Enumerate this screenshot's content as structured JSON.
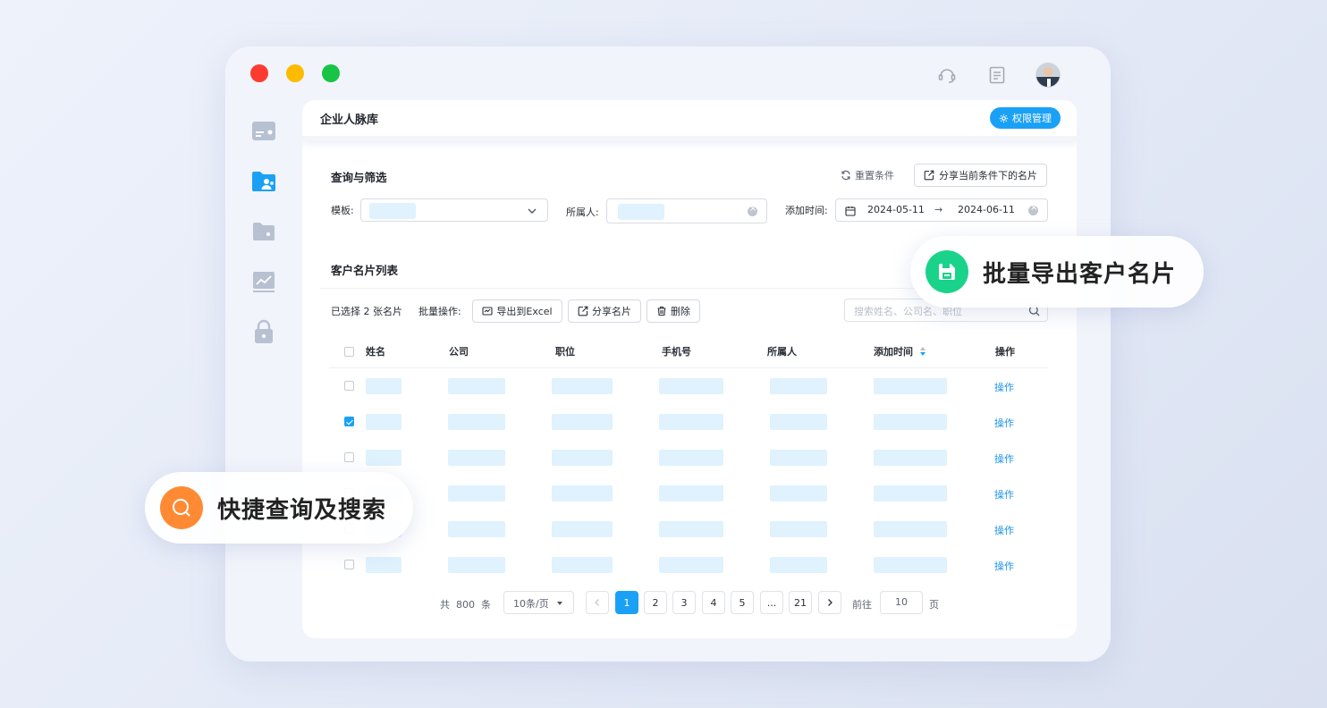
{
  "window": {
    "controls": [
      "close",
      "minimize",
      "maximize"
    ],
    "top_icons": [
      "headset-icon",
      "document-icon",
      "avatar"
    ]
  },
  "sidebar": {
    "items": [
      "card-icon",
      "contacts-folder-icon",
      "folder-icon",
      "chart-icon",
      "lock-icon"
    ],
    "active_index": 1
  },
  "header": {
    "title": "企业人脉库",
    "permission_button": "权限管理"
  },
  "filter": {
    "title": "查询与筛选",
    "reset": "重置条件",
    "share": "分享当前条件下的名片",
    "template_label": "模板:",
    "owner_label": "所属人:",
    "time_label": "添加时间:",
    "date_start": "2024-05-11",
    "date_arrow": "→",
    "date_end": "2024-06-11"
  },
  "list": {
    "title": "客户名片列表",
    "selected_prefix": "已选择",
    "selected_count": "2",
    "selected_suffix": "张名片",
    "batch_label": "批量操作:",
    "export_button": "导出到Excel",
    "share_button": "分享名片",
    "delete_button": "删除",
    "search_placeholder": "搜索姓名、公司名、职位"
  },
  "table": {
    "headers": [
      "姓名",
      "公司",
      "职位",
      "手机号",
      "所属人",
      "添加时间",
      "操作"
    ],
    "row_action": "操作",
    "rows_checked": [
      false,
      true,
      false,
      false,
      false,
      false
    ]
  },
  "pagination": {
    "total_prefix": "共",
    "total": "800",
    "total_suffix": "条",
    "page_size": "10条/页",
    "pages": [
      "1",
      "2",
      "3",
      "4",
      "5",
      "...",
      "21"
    ],
    "current": "1",
    "goto_label": "前往",
    "goto_value": "10",
    "goto_suffix": "页"
  },
  "callouts": {
    "export": "批量导出客户名片",
    "search": "快捷查询及搜索"
  },
  "colors": {
    "primary": "#1aa1f6",
    "export_callout": "#1ad38a",
    "search_callout": "#ff8a33"
  }
}
